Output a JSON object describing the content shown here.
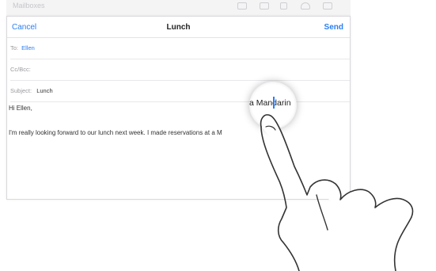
{
  "toolbar": {
    "faded_text": "Mailboxes",
    "icons": [
      "folder-icon",
      "folder-icon",
      "trash-icon",
      "reply-icon",
      "compose-icon"
    ]
  },
  "nav": {
    "cancel": "Cancel",
    "title": "Lunch",
    "send": "Send"
  },
  "fields": {
    "to_label": "To:",
    "to_value": "Ellen",
    "ccbcc_label": "Cc/Bcc:",
    "subject_label": "Subject:",
    "subject_value": "Lunch"
  },
  "body": {
    "greeting": "Hi Ellen,",
    "line1": "I'm really looking forward to our lunch next week. I made reservations at a M"
  },
  "loupe": {
    "text": "a Mandarin"
  },
  "colors": {
    "accent": "#2a7ef6",
    "text": "#333333",
    "placeholder": "#9a9aa0"
  }
}
